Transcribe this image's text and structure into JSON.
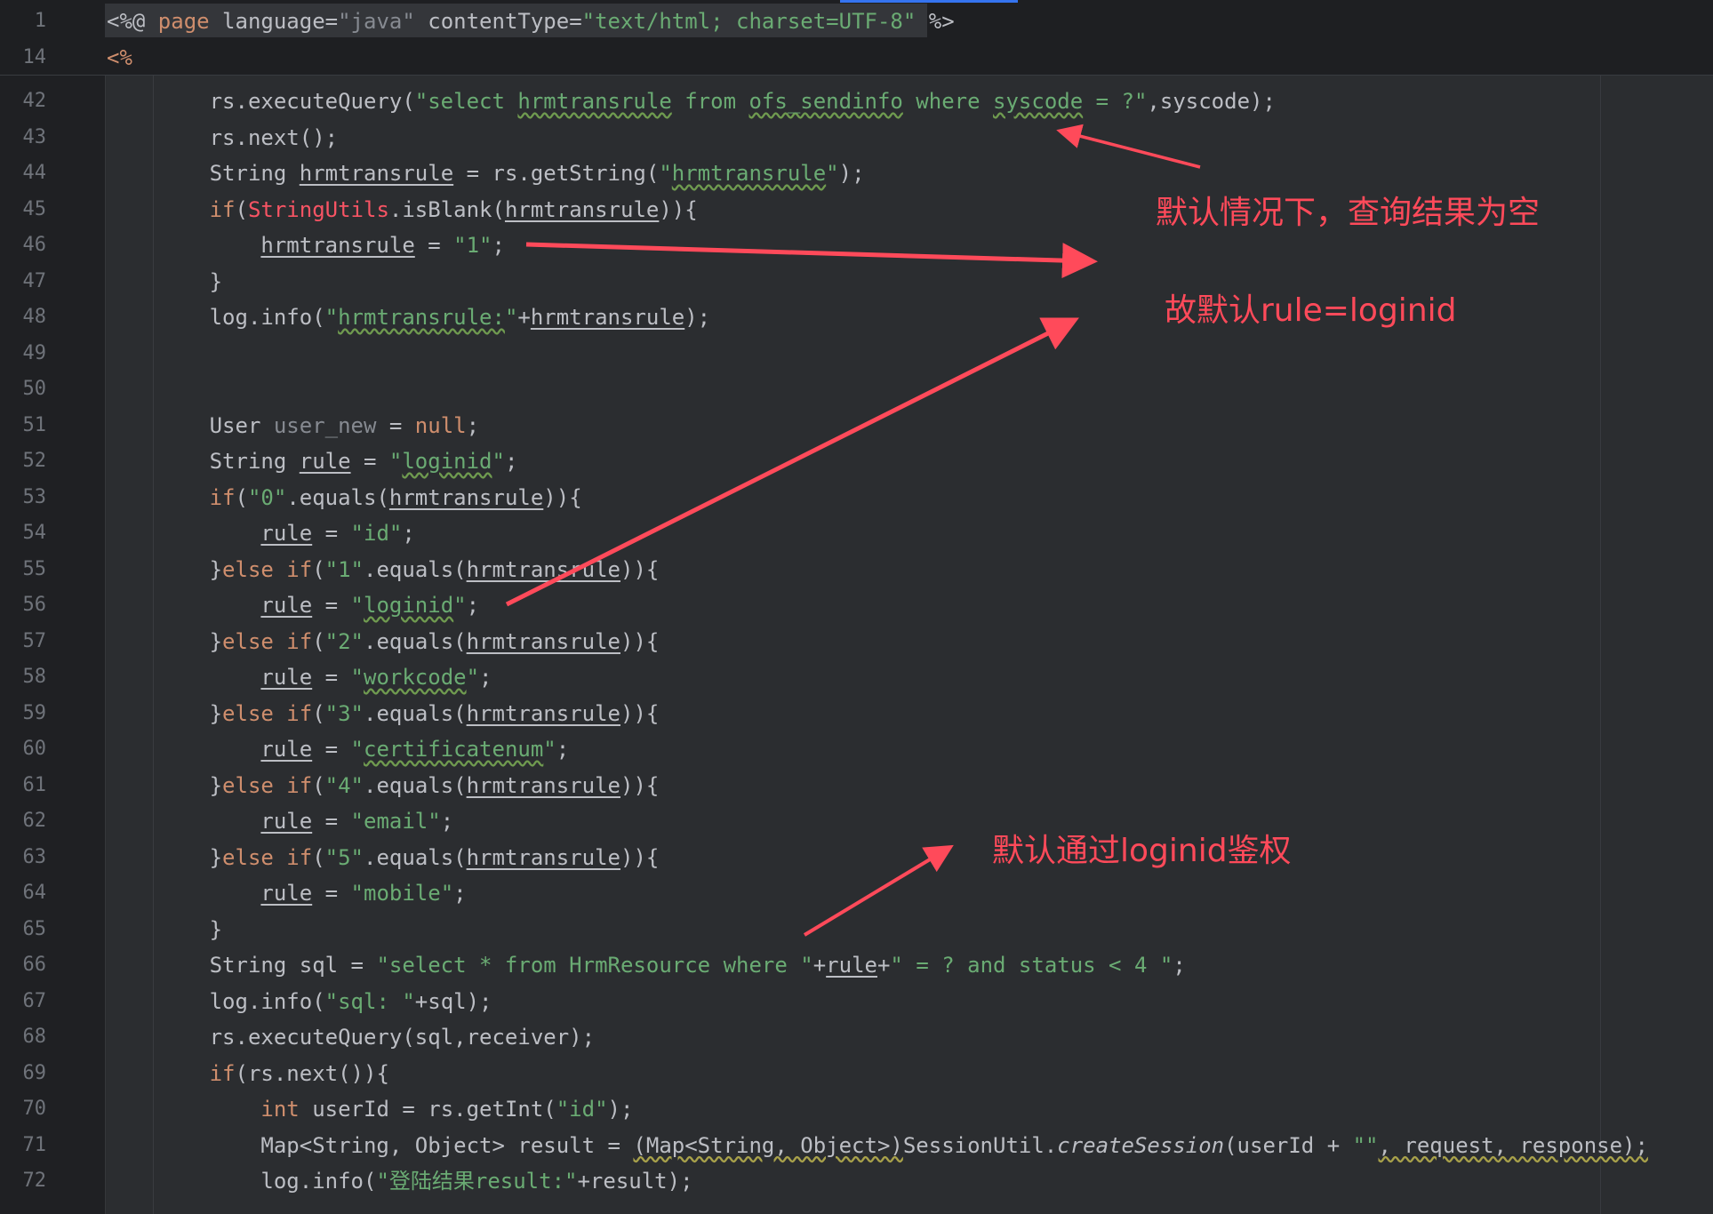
{
  "sticky_lines": [
    {
      "num": "1",
      "tokens": [
        {
          "t": "<%@ ",
          "c": ""
        },
        {
          "t": "page",
          "c": "kw"
        },
        {
          "t": " language=",
          "c": ""
        },
        {
          "t": "\"java\"",
          "c": "dim"
        },
        {
          "t": " contentType=",
          "c": ""
        },
        {
          "t": "\"text/html; charset=UTF-8\"",
          "c": "str"
        },
        {
          "t": " %>",
          "c": ""
        }
      ]
    },
    {
      "num": "14",
      "tokens": [
        {
          "t": "<%",
          "c": "kw"
        }
      ]
    }
  ],
  "code_lines": [
    {
      "num": "42",
      "tokens": [
        {
          "t": "        rs.executeQuery(",
          "c": ""
        },
        {
          "t": "\"select ",
          "c": "str"
        },
        {
          "t": "hrmtransrule",
          "c": "str wavy"
        },
        {
          "t": " from ",
          "c": "str"
        },
        {
          "t": "ofs_sendinfo",
          "c": "str wavy"
        },
        {
          "t": " where ",
          "c": "str"
        },
        {
          "t": "syscode",
          "c": "str wavy"
        },
        {
          "t": " = ?\"",
          "c": "str"
        },
        {
          "t": ",syscode);",
          "c": ""
        }
      ]
    },
    {
      "num": "43",
      "tokens": [
        {
          "t": "        rs.next();",
          "c": ""
        }
      ]
    },
    {
      "num": "44",
      "tokens": [
        {
          "t": "        String ",
          "c": ""
        },
        {
          "t": "hrmtransrule",
          "c": "u"
        },
        {
          "t": " = rs.getString(",
          "c": ""
        },
        {
          "t": "\"",
          "c": "str"
        },
        {
          "t": "hrmtransrule",
          "c": "str wavy"
        },
        {
          "t": "\"",
          "c": "str"
        },
        {
          "t": ");",
          "c": ""
        }
      ]
    },
    {
      "num": "45",
      "tokens": [
        {
          "t": "        ",
          "c": ""
        },
        {
          "t": "if",
          "c": "kw"
        },
        {
          "t": "(",
          "c": ""
        },
        {
          "t": "StringUtils",
          "c": "cls"
        },
        {
          "t": ".isBlank(",
          "c": ""
        },
        {
          "t": "hrmtransrule",
          "c": "u"
        },
        {
          "t": ")){",
          "c": ""
        }
      ]
    },
    {
      "num": "46",
      "tokens": [
        {
          "t": "            ",
          "c": ""
        },
        {
          "t": "hrmtransrule",
          "c": "u"
        },
        {
          "t": " = ",
          "c": ""
        },
        {
          "t": "\"1\"",
          "c": "str"
        },
        {
          "t": ";",
          "c": ""
        }
      ]
    },
    {
      "num": "47",
      "tokens": [
        {
          "t": "        }",
          "c": ""
        }
      ]
    },
    {
      "num": "48",
      "tokens": [
        {
          "t": "        log.info(",
          "c": ""
        },
        {
          "t": "\"",
          "c": "str"
        },
        {
          "t": "hrmtransrule:",
          "c": "str wavy"
        },
        {
          "t": "\"",
          "c": "str"
        },
        {
          "t": "+",
          "c": ""
        },
        {
          "t": "hrmtransrule",
          "c": "u"
        },
        {
          "t": ");",
          "c": ""
        }
      ]
    },
    {
      "num": "49",
      "tokens": []
    },
    {
      "num": "50",
      "tokens": []
    },
    {
      "num": "51",
      "tokens": [
        {
          "t": "        User ",
          "c": ""
        },
        {
          "t": "user_new",
          "c": "dim"
        },
        {
          "t": " = ",
          "c": ""
        },
        {
          "t": "null",
          "c": "kw"
        },
        {
          "t": ";",
          "c": ""
        }
      ]
    },
    {
      "num": "52",
      "tokens": [
        {
          "t": "        String ",
          "c": ""
        },
        {
          "t": "rule",
          "c": "u"
        },
        {
          "t": " = ",
          "c": ""
        },
        {
          "t": "\"",
          "c": "str"
        },
        {
          "t": "loginid",
          "c": "str wavy"
        },
        {
          "t": "\"",
          "c": "str"
        },
        {
          "t": ";",
          "c": ""
        }
      ]
    },
    {
      "num": "53",
      "tokens": [
        {
          "t": "        ",
          "c": ""
        },
        {
          "t": "if",
          "c": "kw"
        },
        {
          "t": "(",
          "c": ""
        },
        {
          "t": "\"0\"",
          "c": "str"
        },
        {
          "t": ".equals(",
          "c": ""
        },
        {
          "t": "hrmtransrule",
          "c": "u"
        },
        {
          "t": ")){",
          "c": ""
        }
      ]
    },
    {
      "num": "54",
      "tokens": [
        {
          "t": "            ",
          "c": ""
        },
        {
          "t": "rule",
          "c": "u"
        },
        {
          "t": " = ",
          "c": ""
        },
        {
          "t": "\"id\"",
          "c": "str"
        },
        {
          "t": ";",
          "c": ""
        }
      ]
    },
    {
      "num": "55",
      "tokens": [
        {
          "t": "        }",
          "c": ""
        },
        {
          "t": "else if",
          "c": "kw"
        },
        {
          "t": "(",
          "c": ""
        },
        {
          "t": "\"1\"",
          "c": "str"
        },
        {
          "t": ".equals(",
          "c": ""
        },
        {
          "t": "hrmtransrule",
          "c": "u"
        },
        {
          "t": ")){",
          "c": ""
        }
      ]
    },
    {
      "num": "56",
      "tokens": [
        {
          "t": "            ",
          "c": ""
        },
        {
          "t": "rule",
          "c": "u"
        },
        {
          "t": " = ",
          "c": ""
        },
        {
          "t": "\"",
          "c": "str"
        },
        {
          "t": "loginid",
          "c": "str wavy"
        },
        {
          "t": "\"",
          "c": "str"
        },
        {
          "t": ";",
          "c": ""
        }
      ]
    },
    {
      "num": "57",
      "tokens": [
        {
          "t": "        }",
          "c": ""
        },
        {
          "t": "else if",
          "c": "kw"
        },
        {
          "t": "(",
          "c": ""
        },
        {
          "t": "\"2\"",
          "c": "str"
        },
        {
          "t": ".equals(",
          "c": ""
        },
        {
          "t": "hrmtransrule",
          "c": "u"
        },
        {
          "t": ")){",
          "c": ""
        }
      ]
    },
    {
      "num": "58",
      "tokens": [
        {
          "t": "            ",
          "c": ""
        },
        {
          "t": "rule",
          "c": "u"
        },
        {
          "t": " = ",
          "c": ""
        },
        {
          "t": "\"",
          "c": "str"
        },
        {
          "t": "workcode",
          "c": "str wavy"
        },
        {
          "t": "\"",
          "c": "str"
        },
        {
          "t": ";",
          "c": ""
        }
      ]
    },
    {
      "num": "59",
      "tokens": [
        {
          "t": "        }",
          "c": ""
        },
        {
          "t": "else if",
          "c": "kw"
        },
        {
          "t": "(",
          "c": ""
        },
        {
          "t": "\"3\"",
          "c": "str"
        },
        {
          "t": ".equals(",
          "c": ""
        },
        {
          "t": "hrmtransrule",
          "c": "u"
        },
        {
          "t": ")){",
          "c": ""
        }
      ]
    },
    {
      "num": "60",
      "tokens": [
        {
          "t": "            ",
          "c": ""
        },
        {
          "t": "rule",
          "c": "u"
        },
        {
          "t": " = ",
          "c": ""
        },
        {
          "t": "\"",
          "c": "str"
        },
        {
          "t": "certificatenum",
          "c": "str wavy"
        },
        {
          "t": "\"",
          "c": "str"
        },
        {
          "t": ";",
          "c": ""
        }
      ]
    },
    {
      "num": "61",
      "tokens": [
        {
          "t": "        }",
          "c": ""
        },
        {
          "t": "else if",
          "c": "kw"
        },
        {
          "t": "(",
          "c": ""
        },
        {
          "t": "\"4\"",
          "c": "str"
        },
        {
          "t": ".equals(",
          "c": ""
        },
        {
          "t": "hrmtransrule",
          "c": "u"
        },
        {
          "t": ")){",
          "c": ""
        }
      ]
    },
    {
      "num": "62",
      "tokens": [
        {
          "t": "            ",
          "c": ""
        },
        {
          "t": "rule",
          "c": "u"
        },
        {
          "t": " = ",
          "c": ""
        },
        {
          "t": "\"email\"",
          "c": "str"
        },
        {
          "t": ";",
          "c": ""
        }
      ]
    },
    {
      "num": "63",
      "tokens": [
        {
          "t": "        }",
          "c": ""
        },
        {
          "t": "else if",
          "c": "kw"
        },
        {
          "t": "(",
          "c": ""
        },
        {
          "t": "\"5\"",
          "c": "str"
        },
        {
          "t": ".equals(",
          "c": ""
        },
        {
          "t": "hrmtransrule",
          "c": "u"
        },
        {
          "t": ")){",
          "c": ""
        }
      ]
    },
    {
      "num": "64",
      "tokens": [
        {
          "t": "            ",
          "c": ""
        },
        {
          "t": "rule",
          "c": "u"
        },
        {
          "t": " = ",
          "c": ""
        },
        {
          "t": "\"mobile\"",
          "c": "str"
        },
        {
          "t": ";",
          "c": ""
        }
      ]
    },
    {
      "num": "65",
      "tokens": [
        {
          "t": "        }",
          "c": ""
        }
      ]
    },
    {
      "num": "66",
      "tokens": [
        {
          "t": "        String sql = ",
          "c": ""
        },
        {
          "t": "\"select * from HrmResource where \"",
          "c": "str"
        },
        {
          "t": "+",
          "c": ""
        },
        {
          "t": "rule",
          "c": "u"
        },
        {
          "t": "+",
          "c": ""
        },
        {
          "t": "\" = ? and status < 4 \"",
          "c": "str"
        },
        {
          "t": ";",
          "c": ""
        }
      ]
    },
    {
      "num": "67",
      "tokens": [
        {
          "t": "        log.info(",
          "c": ""
        },
        {
          "t": "\"sql: \"",
          "c": "str"
        },
        {
          "t": "+sql);",
          "c": ""
        }
      ]
    },
    {
      "num": "68",
      "tokens": [
        {
          "t": "        rs.executeQuery(sql,receiver);",
          "c": ""
        }
      ]
    },
    {
      "num": "69",
      "tokens": [
        {
          "t": "        ",
          "c": ""
        },
        {
          "t": "if",
          "c": "kw"
        },
        {
          "t": "(rs.next()){",
          "c": ""
        }
      ]
    },
    {
      "num": "70",
      "tokens": [
        {
          "t": "            ",
          "c": ""
        },
        {
          "t": "int",
          "c": "kw"
        },
        {
          "t": " userId = rs.getInt(",
          "c": ""
        },
        {
          "t": "\"id\"",
          "c": "str"
        },
        {
          "t": ");",
          "c": ""
        }
      ]
    },
    {
      "num": "71",
      "tokens": [
        {
          "t": "            Map<String, Object> result = ",
          "c": ""
        },
        {
          "t": "(Map<String, Object>)",
          "c": "wavy-y"
        },
        {
          "t": "SessionUtil.",
          "c": ""
        },
        {
          "t": "createSession",
          "c": "it"
        },
        {
          "t": "(userId + ",
          "c": ""
        },
        {
          "t": "\"\"",
          "c": "str"
        },
        {
          "t": ", request, response);",
          "c": "wavy-y"
        }
      ]
    },
    {
      "num": "72",
      "tokens": [
        {
          "t": "            log.info(",
          "c": ""
        },
        {
          "t": "\"登陆结果result:\"",
          "c": "str"
        },
        {
          "t": "+result);",
          "c": ""
        }
      ]
    }
  ],
  "annotations": {
    "note1": "默认情况下，查询结果为空",
    "note2": "故默认rule=loginid",
    "note3": "默认通过loginid鉴权"
  },
  "colors": {
    "background": "#2b2d30",
    "keyword": "#cf8e6d",
    "string": "#6aab73",
    "annotation": "#ff4a5a"
  }
}
